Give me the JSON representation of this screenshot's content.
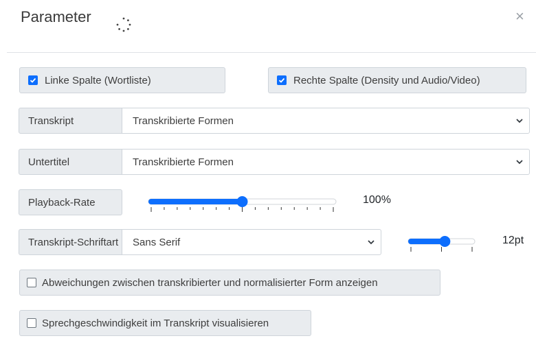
{
  "dialog": {
    "title": "Parameter",
    "close_symbol": "×"
  },
  "columns": {
    "left_label": "Linke Spalte (Wortliste)",
    "left_checked": true,
    "right_label": "Rechte Spalte (Density und Audio/Video)",
    "right_checked": true
  },
  "transcript": {
    "label": "Transkript",
    "selected": "Transkribierte Formen"
  },
  "subtitle": {
    "label": "Untertitel",
    "selected": "Transkribierte Formen"
  },
  "playback": {
    "label": "Playback-Rate",
    "value_text": "100%",
    "level": 0.5
  },
  "font": {
    "label": "Transkript-Schriftart",
    "selected": "Sans Serif",
    "size_text": "12pt",
    "level": 0.55
  },
  "options": {
    "deviations_label": "Abweichungen zwischen transkribierter und normalisierter Form anzeigen",
    "deviations_checked": false,
    "speed_label": "Sprechgeschwindigkeit im Transkript visualisieren",
    "speed_checked": false
  },
  "colors": {
    "accent": "#0d6efd",
    "label_bg": "#e9ecef",
    "border": "#ced4da"
  }
}
